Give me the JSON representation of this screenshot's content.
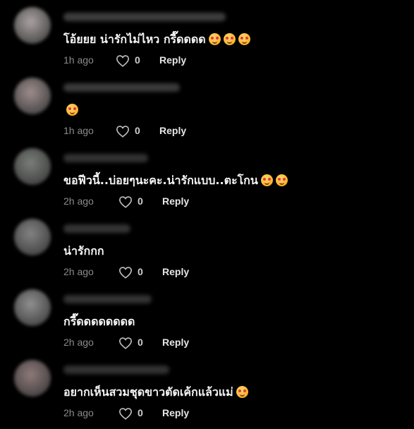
{
  "comments": [
    {
      "text": "โอ้ยยย น่ารักไม่ไหว กรี๊ดดดด",
      "emojis": [
        "smiling-face-with-hearts-icon",
        "smiling-face-with-hearts-icon",
        "smiling-face-with-hearts-icon"
      ],
      "time": "1h ago",
      "likes": "0",
      "reply_label": "Reply",
      "avatar_color": "#c9bfbf",
      "name_color": "#6f6f6f"
    },
    {
      "text": "",
      "emojis": [
        "smiling-face-with-hearts-icon"
      ],
      "time": "1h ago",
      "likes": "0",
      "reply_label": "Reply",
      "avatar_color": "#b9a6a6",
      "name_color": "#6a6a6a"
    },
    {
      "text": "ขอฟีวนี้..บ่อยๆนะคะ.น่ารักแบบ..ตะโกน",
      "emojis": [
        "heart-eyes-icon",
        "heart-eyes-icon"
      ],
      "time": "2h ago",
      "likes": "0",
      "reply_label": "Reply",
      "avatar_color": "#8f958f",
      "name_color": "#5a5a5a"
    },
    {
      "text": "น่ารักกก",
      "emojis": [],
      "time": "2h ago",
      "likes": "0",
      "reply_label": "Reply",
      "avatar_color": "#9a9a9a",
      "name_color": "#5e5e5e"
    },
    {
      "text": "กรี๊ดดดดดดดด",
      "emojis": [],
      "time": "2h ago",
      "likes": "0",
      "reply_label": "Reply",
      "avatar_color": "#a9a9a9",
      "name_color": "#5c5c5c"
    },
    {
      "text": "อยากเห็นสวมชุดขาวตัดเค้กแล้วแม่",
      "emojis": [
        "smiling-face-with-hearts-icon"
      ],
      "time": "2h ago",
      "likes": "0",
      "reply_label": "Reply",
      "avatar_color": "#a89090",
      "name_color": "#5a5a5a"
    }
  ]
}
